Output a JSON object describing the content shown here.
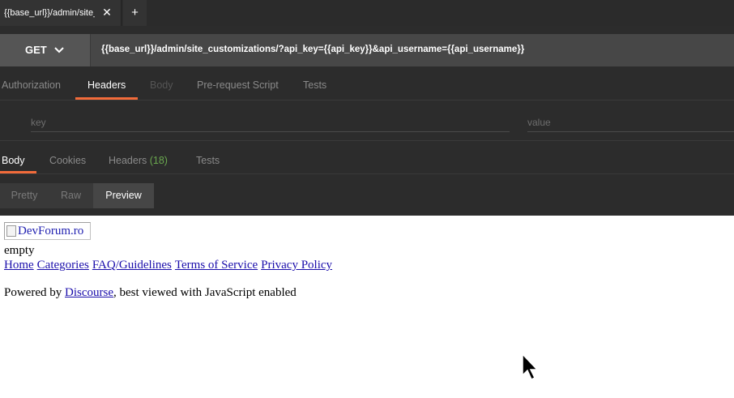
{
  "tab": {
    "title": "{{base_url}}/admin/site_customizations/?api_key={{api_key}}&api_username={{api_username}}",
    "close_glyph": "✕"
  },
  "new_tab": {
    "glyph": "+"
  },
  "request": {
    "method": "GET",
    "url": "{{base_url}}/admin/site_customizations/?api_key={{api_key}}&api_username={{api_username}}"
  },
  "request_tabs": [
    {
      "label": "Authorization"
    },
    {
      "label": "Headers"
    },
    {
      "label": "Body"
    },
    {
      "label": "Pre-request Script"
    },
    {
      "label": "Tests"
    }
  ],
  "headers_editor": {
    "key_placeholder": "key",
    "value_placeholder": "value"
  },
  "response_tabs": {
    "body": "Body",
    "cookies": "Cookies",
    "headers": "Headers",
    "headers_count": "(18)",
    "tests": "Tests"
  },
  "view_modes": [
    {
      "label": "Pretty"
    },
    {
      "label": "Raw"
    },
    {
      "label": "Preview"
    }
  ],
  "preview": {
    "logo_alt": "DevForum.ro",
    "body_text": "empty",
    "footer_links": [
      "Home",
      "Categories",
      "FAQ/Guidelines",
      "Terms of Service",
      "Privacy Policy"
    ],
    "powered_prefix": "Powered by ",
    "powered_link": "Discourse",
    "powered_suffix": ", best viewed with JavaScript enabled"
  },
  "colors": {
    "accent": "#f26b3a",
    "count_green": "#6aa84f",
    "link_blue": "#1a0dab"
  }
}
